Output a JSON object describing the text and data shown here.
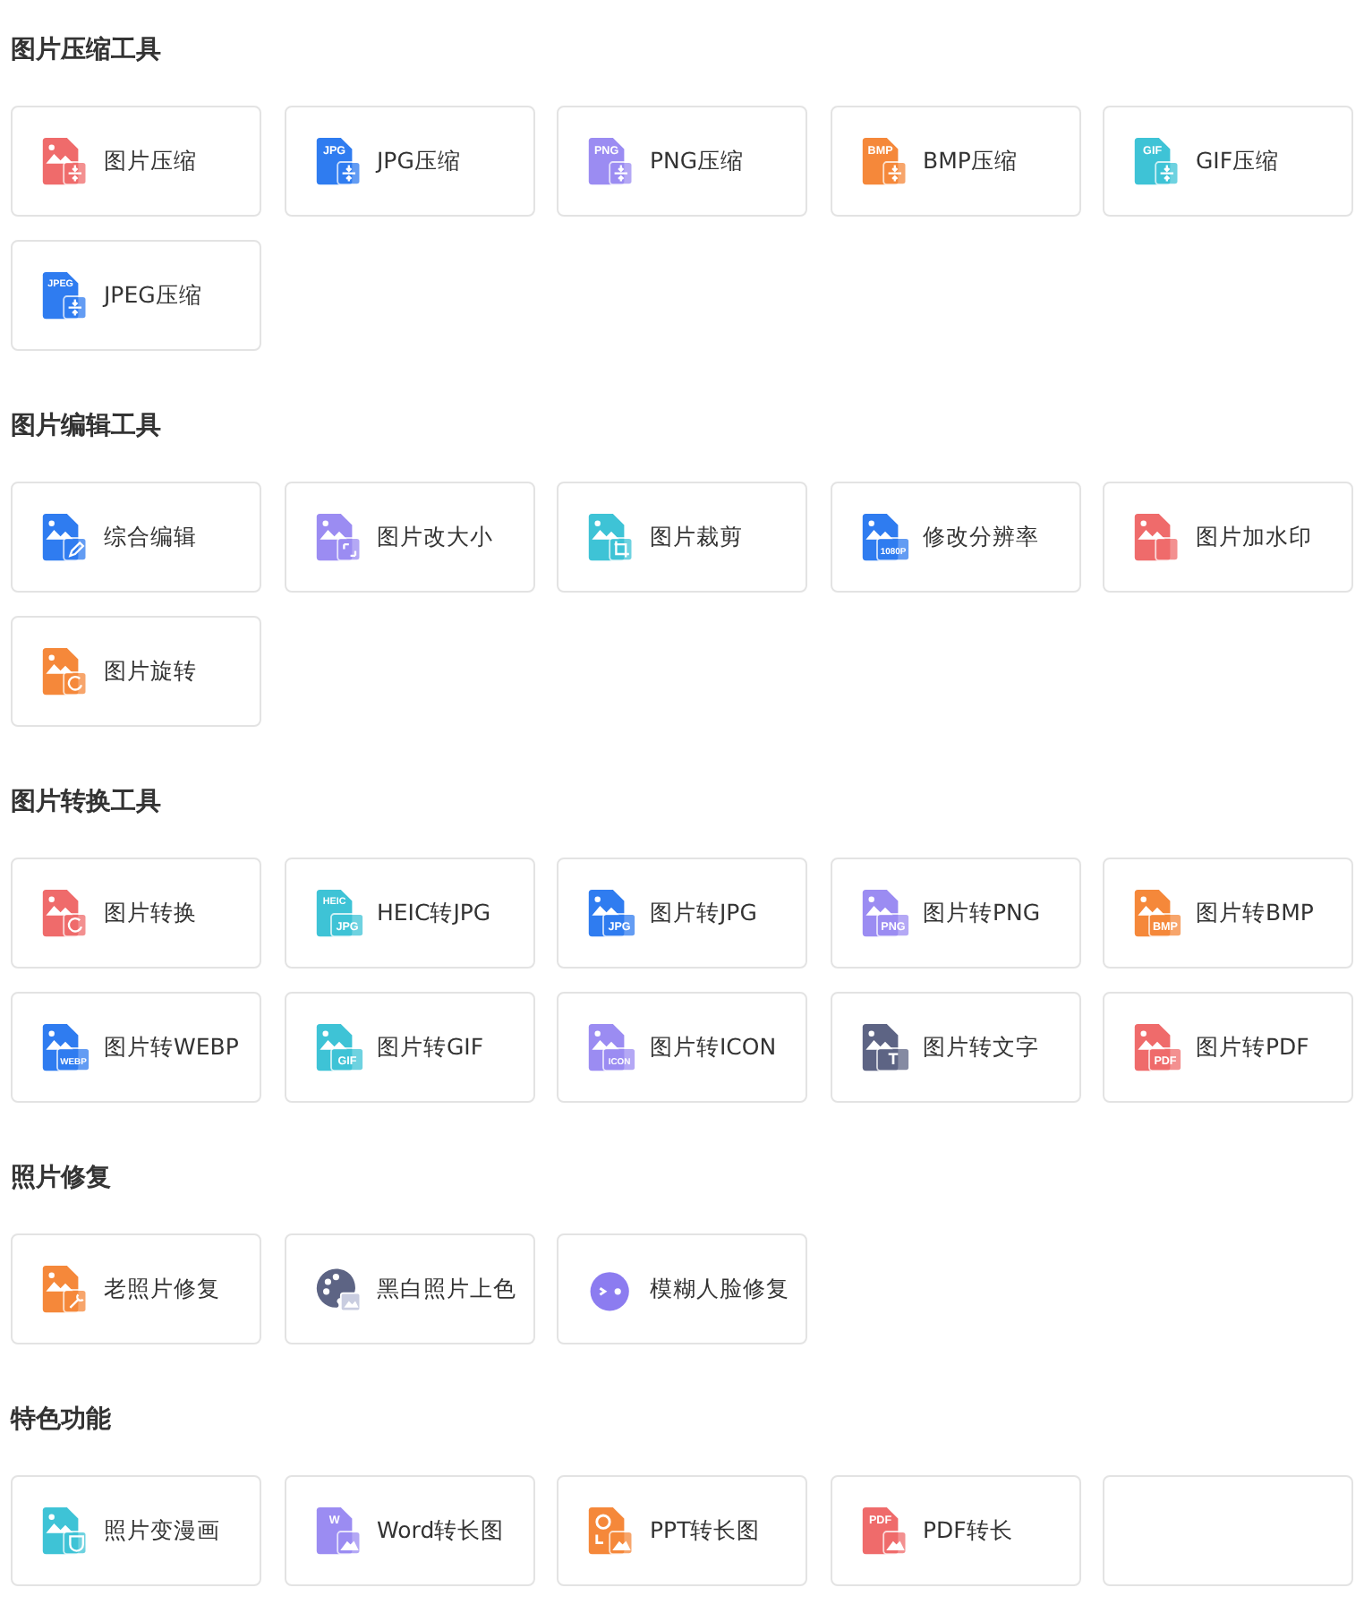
{
  "sections": [
    {
      "title": "图片压缩工具",
      "tools": [
        {
          "kind": "compress",
          "label": "图片压缩",
          "color": "#ef6b6b"
        },
        {
          "kind": "compress",
          "label": "JPG压缩",
          "color": "#2f7cf0",
          "tag": "JPG"
        },
        {
          "kind": "compress",
          "label": "PNG压缩",
          "color": "#9b8cf2",
          "tag": "PNG"
        },
        {
          "kind": "compress",
          "label": "BMP压缩",
          "color": "#f5883a",
          "tag": "BMP"
        },
        {
          "kind": "compress",
          "label": "GIF压缩",
          "color": "#3ec3d6",
          "tag": "GIF"
        },
        {
          "kind": "compress",
          "label": "JPEG压缩",
          "color": "#2f7cf0",
          "tag": "JPEG"
        }
      ]
    },
    {
      "title": "图片编辑工具",
      "tools": [
        {
          "kind": "pen",
          "label": "综合编辑",
          "color": "#2f7cf0"
        },
        {
          "kind": "resize",
          "label": "图片改大小",
          "color": "#9b8cf2"
        },
        {
          "kind": "crop",
          "label": "图片裁剪",
          "color": "#3ec3d6"
        },
        {
          "kind": "convert",
          "label": "修改分辨率",
          "color": "#2f7cf0",
          "subtag": "1080P"
        },
        {
          "kind": "blank",
          "label": "图片加水印",
          "color": "#ef6b6b"
        },
        {
          "kind": "rotate",
          "label": "图片旋转",
          "color": "#f5883a"
        }
      ]
    },
    {
      "title": "图片转换工具",
      "tools": [
        {
          "kind": "rotate",
          "label": "图片转换",
          "color": "#ef6b6b"
        },
        {
          "kind": "convert",
          "label": "HEIC转JPG",
          "color": "#3ec3d6",
          "tag": "HEIC",
          "subtag": "JPG"
        },
        {
          "kind": "convert",
          "label": "图片转JPG",
          "color": "#2f7cf0",
          "subtag": "JPG"
        },
        {
          "kind": "convert",
          "label": "图片转PNG",
          "color": "#9b8cf2",
          "subtag": "PNG"
        },
        {
          "kind": "convert",
          "label": "图片转BMP",
          "color": "#f5883a",
          "subtag": "BMP"
        },
        {
          "kind": "convert",
          "label": "图片转WEBP",
          "color": "#2f7cf0",
          "subtag": "WEBP"
        },
        {
          "kind": "convert",
          "label": "图片转GIF",
          "color": "#3ec3d6",
          "subtag": "GIF"
        },
        {
          "kind": "convert",
          "label": "图片转ICON",
          "color": "#9b8cf2",
          "subtag": "ICON"
        },
        {
          "kind": "convert",
          "label": "图片转文字",
          "color": "#5d6484",
          "subtag": "T"
        },
        {
          "kind": "convert",
          "label": "图片转PDF",
          "color": "#ef6b6b",
          "subtag": "PDF"
        }
      ]
    },
    {
      "title": "照片修复",
      "tools": [
        {
          "kind": "wrench",
          "label": "老照片修复",
          "color": "#f5883a"
        },
        {
          "kind": "palette",
          "label": "黑白照片上色",
          "color": "#5d6484"
        },
        {
          "kind": "face",
          "label": "模糊人脸修复",
          "color": "#8c7cf0"
        }
      ]
    },
    {
      "title": "特色功能",
      "tools": [
        {
          "kind": "cup",
          "label": "照片变漫画",
          "color": "#3ec3d6"
        },
        {
          "kind": "photo",
          "label": "Word转长图",
          "color": "#9b8cf2",
          "tag": "W"
        },
        {
          "kind": "slides",
          "label": "PPT转长图",
          "color": "#f5883a"
        },
        {
          "kind": "photo",
          "label": "PDF转长",
          "color": "#ef6b6b",
          "tag": "PDF"
        },
        {
          "kind": "empty"
        }
      ]
    }
  ]
}
